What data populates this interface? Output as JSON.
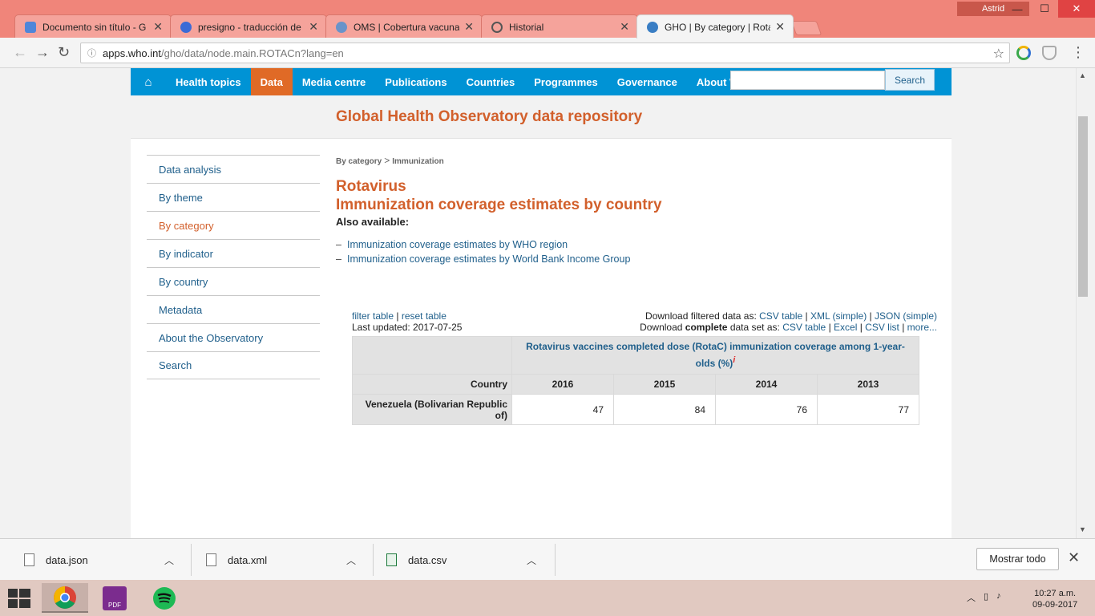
{
  "browser": {
    "tabs": [
      {
        "title": "Documento sin título - G",
        "favicon_color": "#4f86d9"
      },
      {
        "title": "presigno - traducción de",
        "favicon_color": "#3b6bd6"
      },
      {
        "title": "OMS | Cobertura vacunal",
        "favicon_color": "#6a93c9"
      },
      {
        "title": "Historial",
        "favicon_color": "#555555"
      },
      {
        "title": "GHO | By category | Rota",
        "favicon_color": "#3a7ec4"
      }
    ],
    "user": "Astrid",
    "url_host": "apps.who.int",
    "url_path": "/gho/data/node.main.ROTACn?lang=en"
  },
  "topnav": {
    "items": [
      "Health topics",
      "Data",
      "Media centre",
      "Publications",
      "Countries",
      "Programmes",
      "Governance",
      "About WHO"
    ],
    "active": "Data",
    "search_label": "Search"
  },
  "banner": {
    "title": "Global Health Observatory data repository"
  },
  "sidebar": {
    "items": [
      "Data analysis",
      "By theme",
      "By category",
      "By indicator",
      "By country",
      "Metadata",
      "About the Observatory",
      "Search"
    ],
    "active": "By category"
  },
  "breadcrumb": {
    "first": "By category",
    "sep": ">",
    "second": "Immunization"
  },
  "content": {
    "title1": "Rotavirus",
    "title2": "Immunization coverage estimates by country",
    "also": "Also available:",
    "links": [
      "Immunization coverage estimates by WHO region",
      "Immunization coverage estimates by World Bank Income Group"
    ]
  },
  "tools": {
    "filter": "filter table",
    "reset": "reset table",
    "updated": "Last updated: 2017-07-25",
    "dl_filtered_label": "Download filtered data as:",
    "dl_filtered": [
      "CSV table",
      "XML (simple)",
      "JSON (simple)"
    ],
    "dl_complete_pre": "Download",
    "dl_complete_bold": "complete",
    "dl_complete_post": "data set as:",
    "dl_complete": [
      "CSV table",
      "Excel",
      "CSV list",
      "more..."
    ]
  },
  "table": {
    "indicator": "Rotavirus vaccines completed dose (RotaC) immunization coverage among 1-year-olds (%)",
    "info_mark": "i",
    "country_header": "Country",
    "years": [
      "2016",
      "2015",
      "2014",
      "2013"
    ],
    "rows": [
      {
        "country": "Venezuela (Bolivarian Republic of)",
        "values": [
          "47",
          "84",
          "76",
          "77"
        ]
      }
    ]
  },
  "downloads": {
    "items": [
      "data.json",
      "data.xml",
      "data.csv"
    ],
    "show_all": "Mostrar todo"
  },
  "taskbar": {
    "time": "10:27 a.m.",
    "date": "09-09-2017",
    "pdf_label": "PDF"
  }
}
